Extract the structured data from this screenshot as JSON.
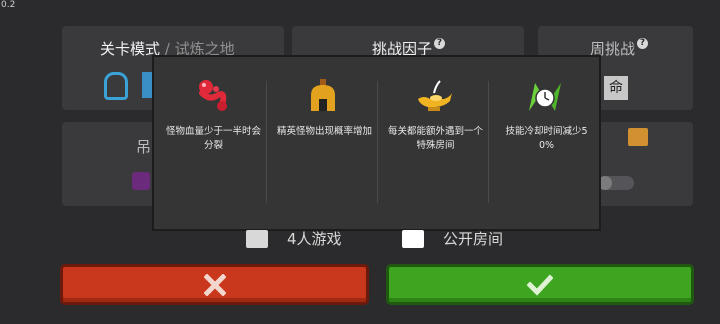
{
  "version": "0.2",
  "header": {
    "mode_label": "关卡模式",
    "mode_separator": "/",
    "mode_value": "试炼之地",
    "factors_title": "挑战因子",
    "weekly_title": "周挑战"
  },
  "background": {
    "partial_label": "吊",
    "command_glyph": "命"
  },
  "popup": {
    "factors": [
      {
        "icon": "red-worm-icon",
        "text": "怪物血量少于一半时会分裂"
      },
      {
        "icon": "spartan-helmet-icon",
        "text": "精英怪物出现概率增加"
      },
      {
        "icon": "magic-lamp-icon",
        "text": "每关都能额外遇到一个特殊房间"
      },
      {
        "icon": "stopwatch-arrows-icon",
        "text": "技能冷却时间减少50%"
      }
    ]
  },
  "options": {
    "four_players_label": "4人游戏",
    "public_room_label": "公开房间"
  },
  "buttons": {
    "cancel_icon": "x-icon",
    "confirm_icon": "check-icon"
  },
  "colors": {
    "cancel": "#c9371c",
    "confirm": "#3ea521",
    "popup_bg": "#353536"
  }
}
